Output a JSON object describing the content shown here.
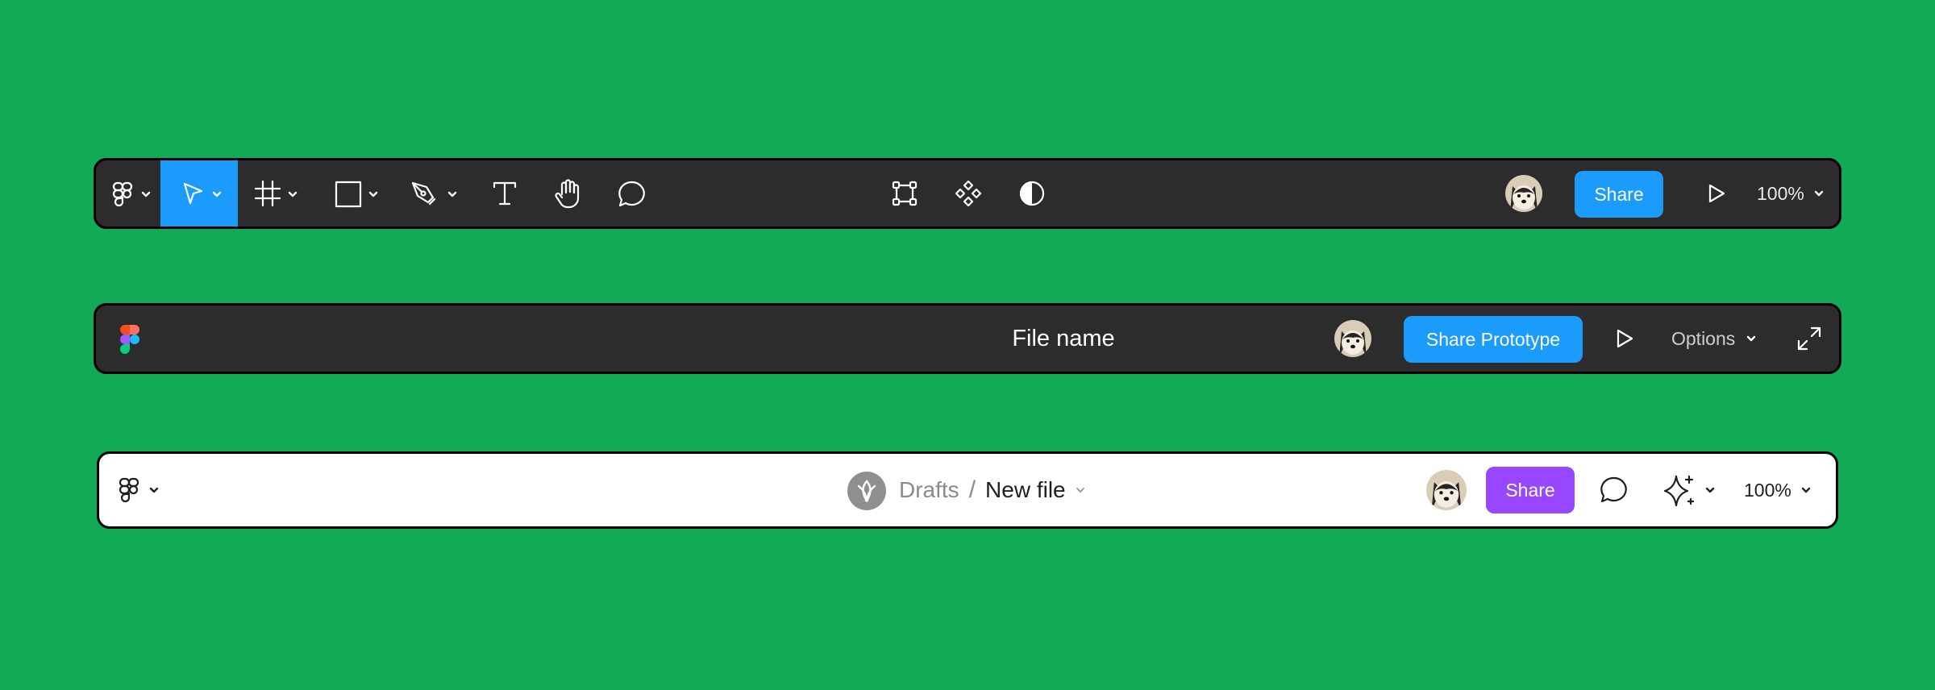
{
  "colors": {
    "background": "#12a957",
    "dark_bar": "#2c2c2c",
    "accent_blue": "#1b9cfc",
    "accent_purple": "#9747ff"
  },
  "toolbar_editor": {
    "tools": [
      {
        "icon": "figma-menu-icon",
        "has_dropdown": true
      },
      {
        "icon": "move-cursor-icon",
        "has_dropdown": true,
        "active": true
      },
      {
        "icon": "frame-icon",
        "has_dropdown": true
      },
      {
        "icon": "rectangle-icon",
        "has_dropdown": true
      },
      {
        "icon": "pen-icon",
        "has_dropdown": true
      },
      {
        "icon": "text-icon",
        "has_dropdown": false
      },
      {
        "icon": "hand-icon",
        "has_dropdown": false
      },
      {
        "icon": "comment-icon",
        "has_dropdown": false
      }
    ],
    "center_tools": [
      "transform-icon",
      "component-icon",
      "contrast-icon"
    ],
    "share_label": "Share",
    "zoom": "100%"
  },
  "toolbar_prototype": {
    "file_name": "File name",
    "share_label": "Share Prototype",
    "options_label": "Options"
  },
  "toolbar_light": {
    "breadcrumb_parent": "Drafts",
    "breadcrumb_separator": "/",
    "file_name": "New file",
    "share_label": "Share",
    "zoom": "100%"
  }
}
